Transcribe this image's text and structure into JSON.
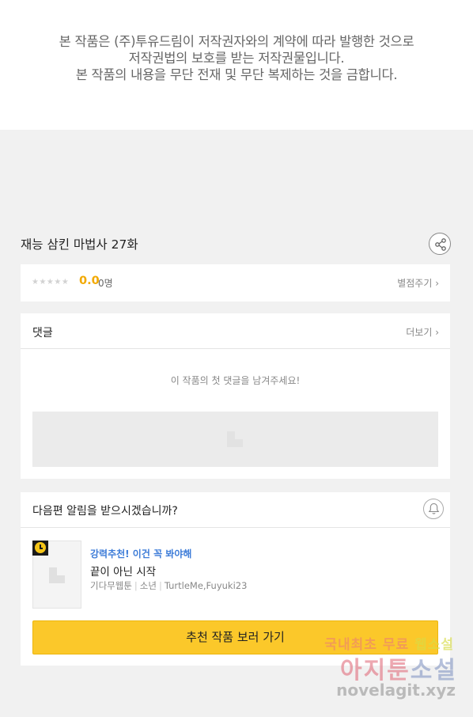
{
  "notice": {
    "lines": [
      "본 작품은 (주)투유드림이 저작권자와의 계약에 따라 발행한 것으로",
      "저작권법의 보호를 받는 저작권물입니다.",
      "본 작품의 내용을 무단 전재 및 무단 복제하는 것을 금합니다."
    ]
  },
  "episode": {
    "title": "재능 삼킨 마법사 27화",
    "share_icon": "share-icon"
  },
  "rating": {
    "stars": "★★★★★",
    "score": "0.0",
    "count": "0명",
    "link": "별점주기 ›"
  },
  "comments": {
    "title": "댓글",
    "more": "더보기 ›",
    "empty": "이 작품의 첫 댓글을 남겨주세요!"
  },
  "next": {
    "question": "다음편 알림을 받으시겠습니까?",
    "bell_icon": "bell-icon",
    "recommend": {
      "tag": "강력추천! 이건 꼭 봐야해",
      "title": "끝이 아닌 시작",
      "meta": [
        "기다무웹툰",
        "소년",
        "TurtleMe,Fuyuki23"
      ]
    },
    "cta": "추천 작품 보러 가기"
  },
  "watermark": {
    "line1_a": "국내최초 무료 ",
    "line1_b": "웹소설",
    "line2_a": "아지툰",
    "line2_b": "소설",
    "line3": "novelagit.xyz"
  },
  "colors": {
    "accent_yellow": "#fbc82a",
    "score_orange": "#f2a900",
    "tag_blue": "#3d7cd8"
  }
}
